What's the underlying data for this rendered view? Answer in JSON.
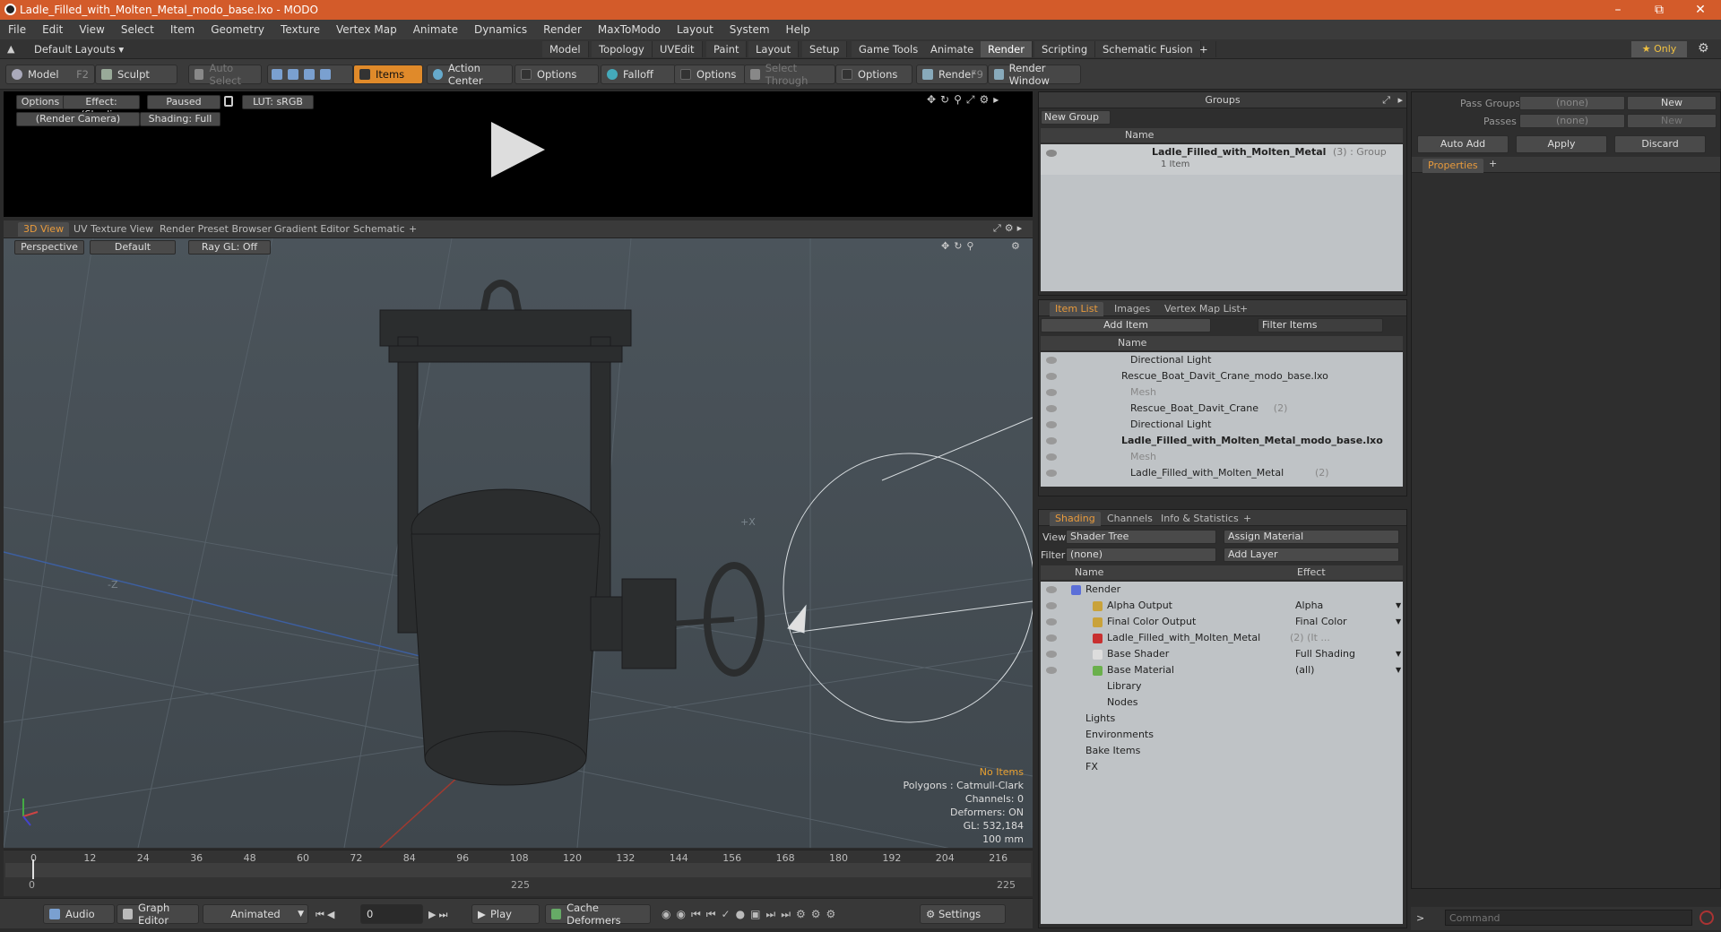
{
  "title": "Ladle_Filled_with_Molten_Metal_modo_base.lxo - MODO",
  "menu": [
    "File",
    "Edit",
    "View",
    "Select",
    "Item",
    "Geometry",
    "Texture",
    "Vertex Map",
    "Animate",
    "Dynamics",
    "Render",
    "MaxToModo",
    "Layout",
    "System",
    "Help"
  ],
  "layouts_label": "Default Layouts ▾",
  "layout_tabs": [
    "Model",
    "Topology",
    "UVEdit",
    "Paint",
    "Layout",
    "Setup",
    "Game Tools",
    "Animate",
    "Render",
    "Scripting",
    "Schematic Fusion",
    "+"
  ],
  "only_label": "★ Only",
  "toolbar": {
    "model": "Model",
    "model_key": "F2",
    "sculpt": "Sculpt",
    "auto_select": "Auto Select",
    "items": "Items",
    "action_center": "Action Center",
    "options1": "Options",
    "falloff": "Falloff",
    "options2": "Options",
    "select_through": "Select Through",
    "options3": "Options",
    "render": "Render",
    "render_key": "F9",
    "render_window": "Render Window"
  },
  "render_view": {
    "options": "Options",
    "effect": "Effect: (Shadi...",
    "paused": "Paused",
    "lut": "LUT: sRGB",
    "camera": "(Render Camera)",
    "shading": "Shading: Full"
  },
  "view_tabs": [
    "3D View",
    "UV Texture View",
    "Render Preset Browser",
    "Gradient Editor",
    "Schematic",
    "+"
  ],
  "viewport": {
    "perspective": "Perspective",
    "default": "Default",
    "raygl": "Ray GL: Off",
    "axis_x": "+X",
    "axis_z": "-Z"
  },
  "hud": {
    "no_items": "No Items",
    "polygons": "Polygons : Catmull-Clark",
    "channels": "Channels: 0",
    "deformers": "Deformers: ON",
    "gl": "GL: 532,184",
    "scale": "100 mm"
  },
  "timeline": {
    "ticks": [
      "0",
      "12",
      "24",
      "36",
      "48",
      "60",
      "72",
      "84",
      "96",
      "108",
      "120",
      "132",
      "144",
      "156",
      "168",
      "180",
      "192",
      "204",
      "216"
    ],
    "sub_ticks": [
      "0",
      "225",
      "225"
    ]
  },
  "bottom": {
    "audio": "Audio",
    "graph_editor": "Graph Editor",
    "animated": "Animated",
    "frame": "0",
    "play": "Play",
    "cache": "Cache Deformers",
    "settings": "Settings"
  },
  "groups": {
    "title": "Groups",
    "new_group": "New Group",
    "col_name": "Name",
    "item": "Ladle_Filled_with_Molten_Metal",
    "item_suffix": "(3) : Group",
    "item_sub": "1 Item"
  },
  "itemlist": {
    "tabs": [
      "Item List",
      "Images",
      "Vertex Map List",
      "+"
    ],
    "add_item": "Add Item",
    "filter": "Filter Items",
    "col_name": "Name",
    "rows": [
      {
        "label": "Directional Light",
        "indent": 1,
        "dim": false,
        "bold": false,
        "count": ""
      },
      {
        "label": "Rescue_Boat_Davit_Crane_modo_base.lxo",
        "indent": 0,
        "dim": false,
        "bold": false,
        "count": ""
      },
      {
        "label": "Mesh",
        "indent": 1,
        "dim": true,
        "bold": false,
        "count": ""
      },
      {
        "label": "Rescue_Boat_Davit_Crane",
        "indent": 1,
        "dim": false,
        "bold": false,
        "count": "(2)"
      },
      {
        "label": "Directional Light",
        "indent": 1,
        "dim": false,
        "bold": false,
        "count": ""
      },
      {
        "label": "Ladle_Filled_with_Molten_Metal_modo_base.lxo",
        "indent": 0,
        "dim": false,
        "bold": true,
        "count": ""
      },
      {
        "label": "Mesh",
        "indent": 1,
        "dim": true,
        "bold": false,
        "count": ""
      },
      {
        "label": "Ladle_Filled_with_Molten_Metal",
        "indent": 1,
        "dim": false,
        "bold": false,
        "count": "(2)"
      }
    ]
  },
  "shading": {
    "tabs": [
      "Shading",
      "Channels",
      "Info & Statistics",
      "+"
    ],
    "view_label": "View",
    "view_value": "Shader Tree",
    "assign": "Assign Material",
    "filter_label": "Filter",
    "filter_value": "(none)",
    "add_layer": "Add Layer",
    "col_name": "Name",
    "col_effect": "Effect",
    "rows": [
      {
        "label": "Render",
        "effect": "",
        "indent": 0,
        "color": "#5b6fd8"
      },
      {
        "label": "Alpha Output",
        "effect": "Alpha",
        "indent": 1,
        "color": "#c9a23a"
      },
      {
        "label": "Final Color Output",
        "effect": "Final Color",
        "indent": 1,
        "color": "#c9a23a"
      },
      {
        "label": "Ladle_Filled_with_Molten_Metal",
        "effect": "",
        "indent": 1,
        "color": "#c83030",
        "count": "(2) (It ..."
      },
      {
        "label": "Base Shader",
        "effect": "Full Shading",
        "indent": 1,
        "color": "#dddddd"
      },
      {
        "label": "Base Material",
        "effect": "(all)",
        "indent": 1,
        "color": "#6ab04c"
      },
      {
        "label": "Library",
        "effect": "",
        "indent": 1,
        "color": ""
      },
      {
        "label": "Nodes",
        "effect": "",
        "indent": 1,
        "color": ""
      },
      {
        "label": "Lights",
        "effect": "",
        "indent": 0,
        "color": ""
      },
      {
        "label": "Environments",
        "effect": "",
        "indent": 0,
        "color": ""
      },
      {
        "label": "Bake Items",
        "effect": "",
        "indent": 0,
        "color": ""
      },
      {
        "label": "FX",
        "effect": "",
        "indent": 0,
        "color": ""
      }
    ]
  },
  "passes": {
    "pass_groups": "Pass Groups",
    "passes": "Passes",
    "none": "(none)",
    "new": "New",
    "auto_add": "Auto Add",
    "apply": "Apply",
    "discard": "Discard",
    "properties": "Properties"
  },
  "command_placeholder": "Command"
}
